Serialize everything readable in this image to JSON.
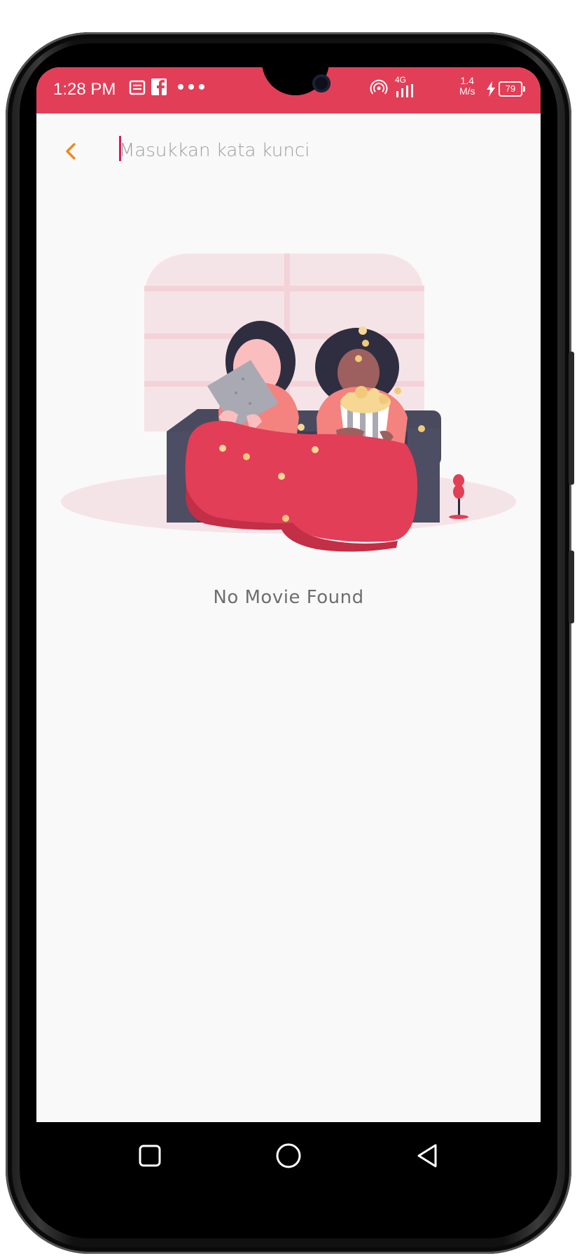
{
  "status_bar": {
    "time": "1:28 PM",
    "network_type": "4G",
    "net_speed_value": "1.4",
    "net_speed_unit": "M/s",
    "battery_level": "79",
    "background_color": "#e23e57",
    "icons": [
      "message-icon",
      "facebook-icon",
      "more-notifications-icon",
      "hotspot-icon",
      "signal-icon",
      "charging-icon",
      "battery-icon"
    ]
  },
  "search": {
    "placeholder": "Masukkan kata kunci",
    "value": "",
    "back_icon": "chevron-left-icon",
    "back_icon_color": "#f0881a"
  },
  "empty_state": {
    "message": "No Movie Found",
    "illustration": "two-people-on-couch-with-popcorn"
  },
  "navigation": {
    "buttons": [
      "recent-apps-icon",
      "home-icon",
      "back-triangle-icon"
    ]
  },
  "colors": {
    "accent": "#e23e57",
    "background": "#f9f9f9",
    "muted_text": "#6e6e6e"
  }
}
